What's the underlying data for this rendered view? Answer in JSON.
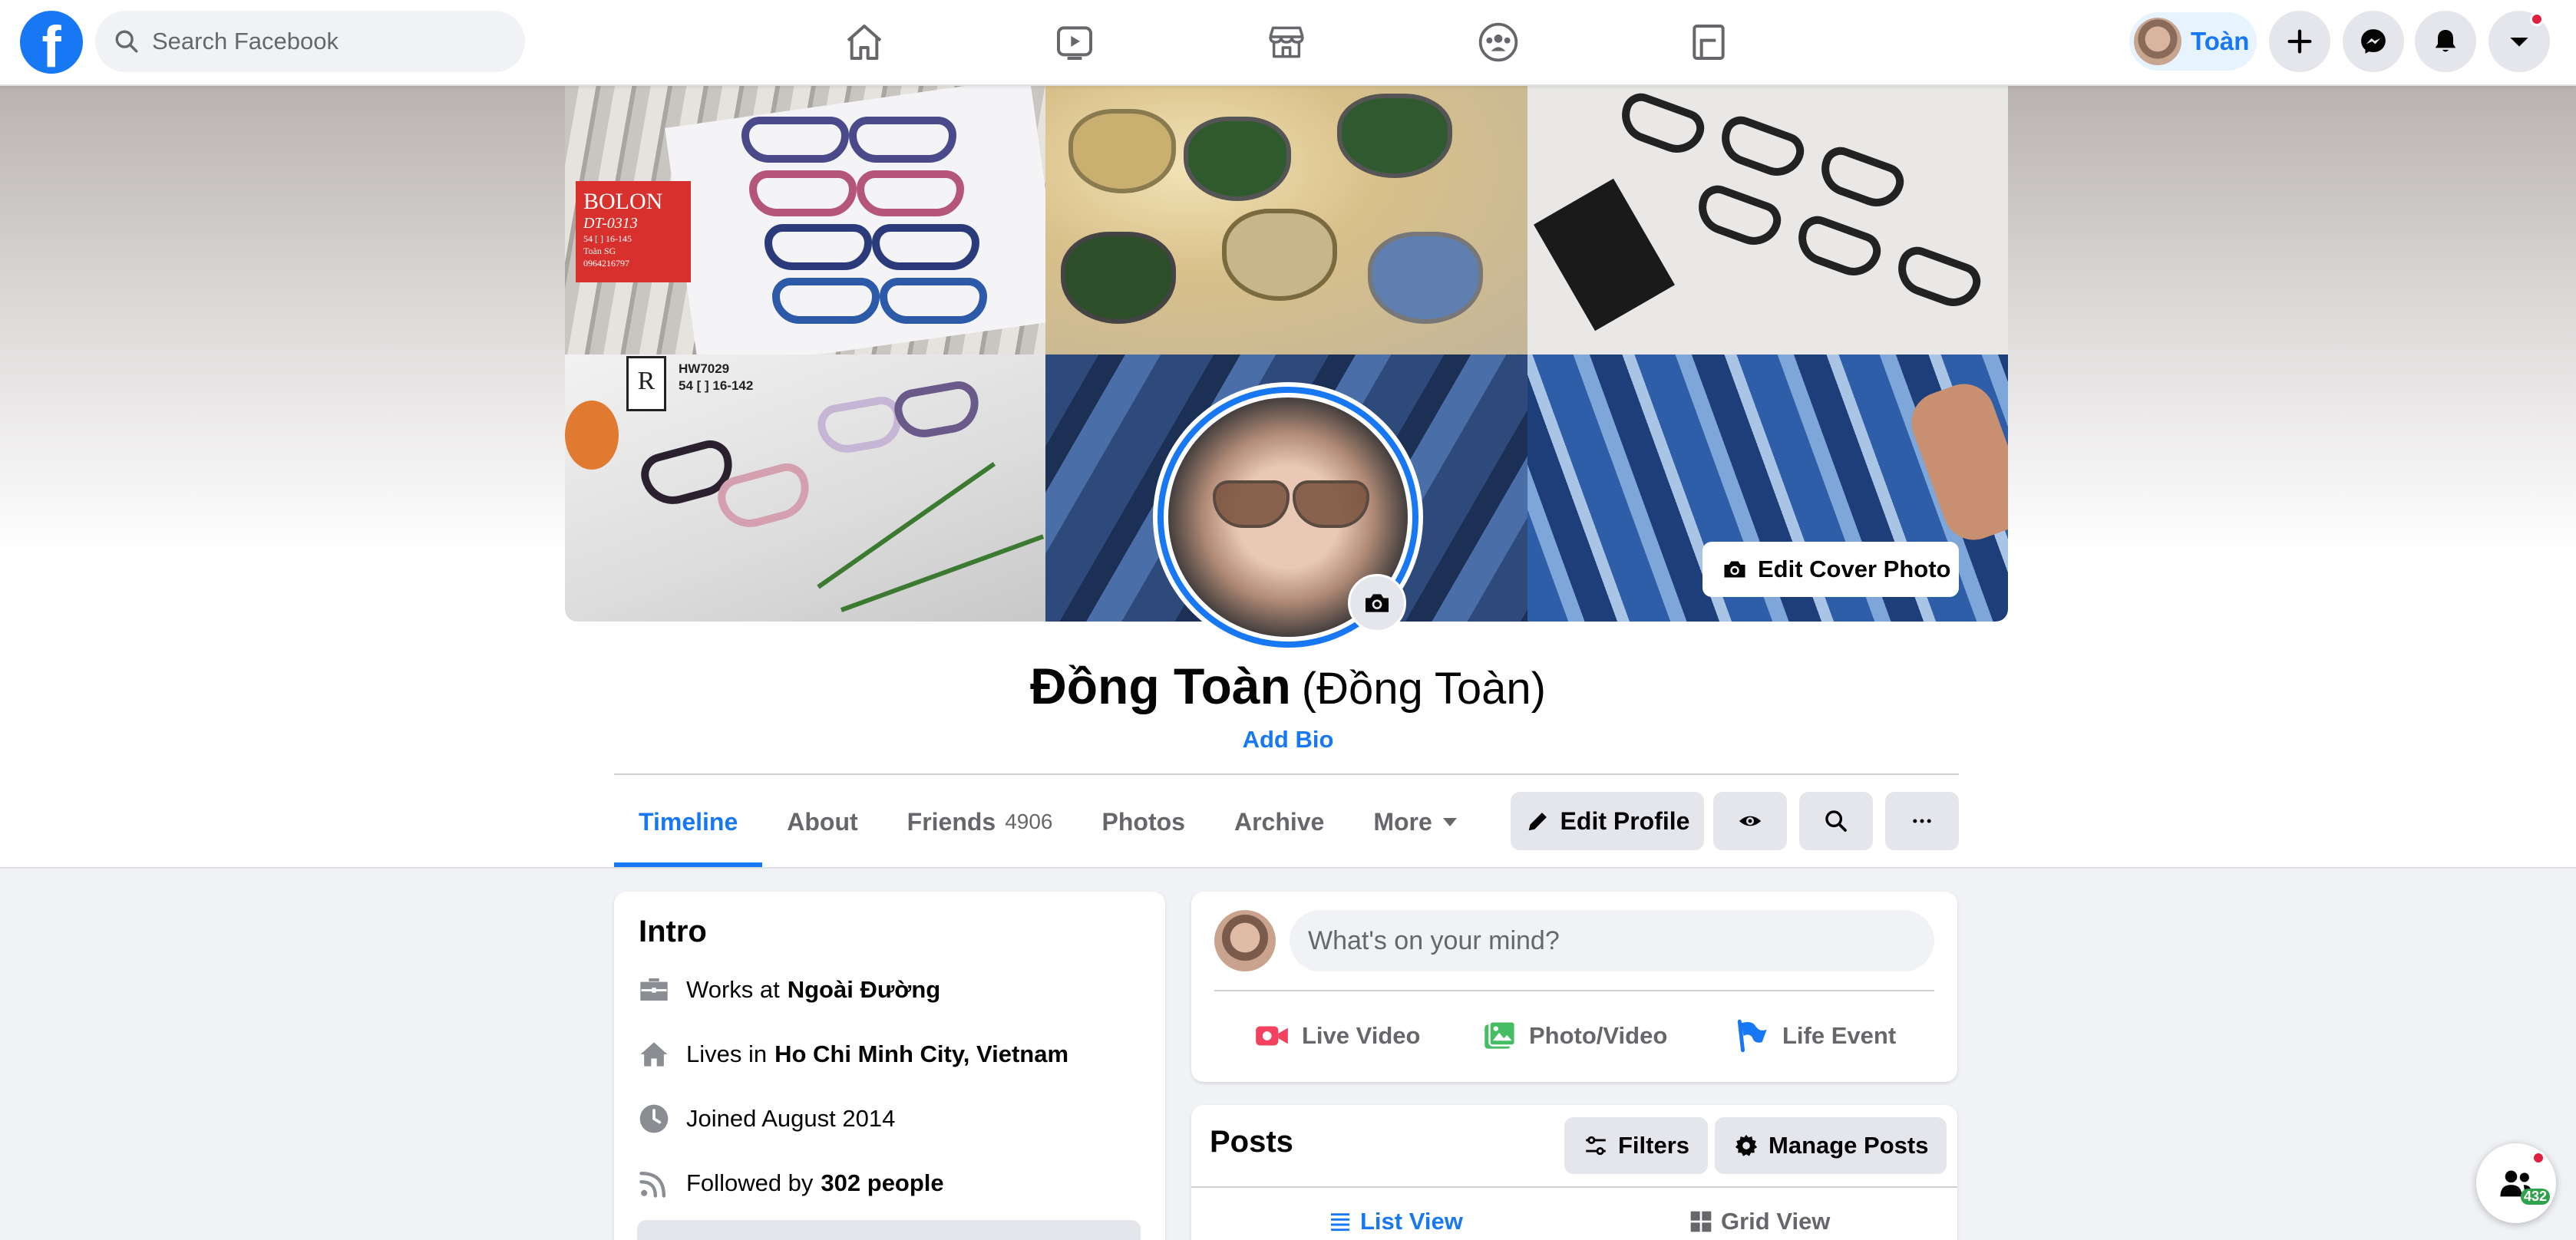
{
  "nav": {
    "logo_letter": "f",
    "search_placeholder": "Search Facebook",
    "icons": [
      "home-icon",
      "watch-icon",
      "marketplace-icon",
      "groups-icon",
      "gaming-icon"
    ],
    "user_chip_name": "Toàn"
  },
  "cover": {
    "edit_cover_label": "Edit Cover Photo",
    "bolon_brand": "BOLON",
    "bolon_code": "DT-0313",
    "bolon_size": "54 [ ] 16-145",
    "bolon_owner": "Toàn SG",
    "bolon_phone": "0964216797",
    "rr_logo": "R",
    "rr_model": "HW7029",
    "rr_size": "54 [ ] 16-142"
  },
  "profile": {
    "name": "Đồng Toàn",
    "alt_name": "(Đồng Toàn)",
    "add_bio": "Add Bio"
  },
  "tabs": [
    {
      "label": "Timeline"
    },
    {
      "label": "About"
    },
    {
      "label": "Friends",
      "count": "4906"
    },
    {
      "label": "Photos"
    },
    {
      "label": "Archive"
    },
    {
      "label": "More"
    }
  ],
  "actions": {
    "edit_profile": "Edit Profile"
  },
  "intro": {
    "title": "Intro",
    "work_prefix": "Works at",
    "work_place": "Ngoài Đường",
    "lives_prefix": "Lives in",
    "lives_place": "Ho Chi Minh City, Vietnam",
    "joined": "Joined August 2014",
    "followed_prefix": "Followed by",
    "followed_count": "302 people"
  },
  "composer": {
    "placeholder": "What's on your mind?",
    "live_video": "Live Video",
    "photo_video": "Photo/Video",
    "life_event": "Life Event"
  },
  "posts": {
    "title": "Posts",
    "filters": "Filters",
    "manage": "Manage Posts",
    "list_view": "List View",
    "grid_view": "Grid View"
  },
  "friends_float": {
    "count": "432"
  },
  "colors": {
    "brand": "#1877f2",
    "background": "#f0f2f5",
    "button_gray": "#e4e6eb",
    "live_red": "#f3425f",
    "photo_green": "#45bd62",
    "event_blue": "#1877f2"
  }
}
